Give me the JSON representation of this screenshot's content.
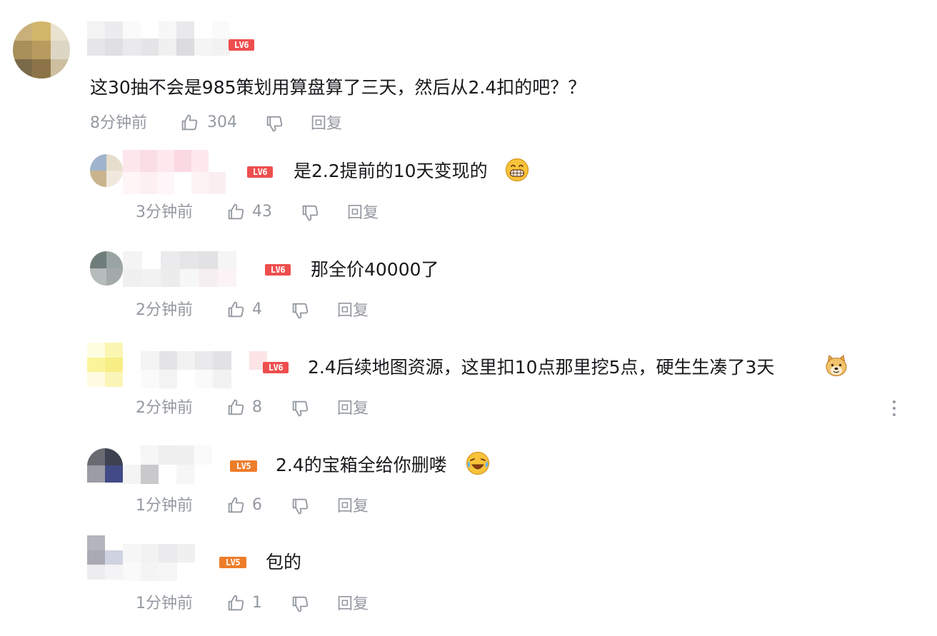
{
  "comment": {
    "level": "LV6",
    "text": "这30抽不会是985策划用算盘算了三天，然后从2.4扣的吧？？",
    "time": "8分钟前",
    "likes": "304",
    "reply": "回复"
  },
  "replies": [
    {
      "level": "LV6",
      "text": "是2.2提前的10天变现的",
      "emoji": "grin-emoji",
      "time": "3分钟前",
      "likes": "43",
      "reply": "回复"
    },
    {
      "level": "LV6",
      "text": "那全价40000了",
      "time": "2分钟前",
      "likes": "4",
      "reply": "回复"
    },
    {
      "level": "LV6",
      "text": "2.4后续地图资源，这里扣10点那里挖5点，硬生生凑了3天",
      "emoji": "doge-emoji",
      "time": "2分钟前",
      "likes": "8",
      "reply": "回复"
    },
    {
      "level": "LV5",
      "text": "2.4的宝箱全给你删喽",
      "emoji": "laugh-cry-emoji",
      "time": "1分钟前",
      "likes": "6",
      "reply": "回复"
    },
    {
      "level": "LV5",
      "text": "包的",
      "time": "1分钟前",
      "likes": "1",
      "reply": "回复"
    }
  ],
  "icons": {
    "like": "thumbs-up-icon",
    "dislike": "thumbs-down-icon",
    "more": "more-vertical-icon"
  },
  "colors": {
    "text": "#18191c",
    "meta": "#9499a0",
    "lv6": "#ee4e4e",
    "lv5": "#ee7d2a"
  }
}
